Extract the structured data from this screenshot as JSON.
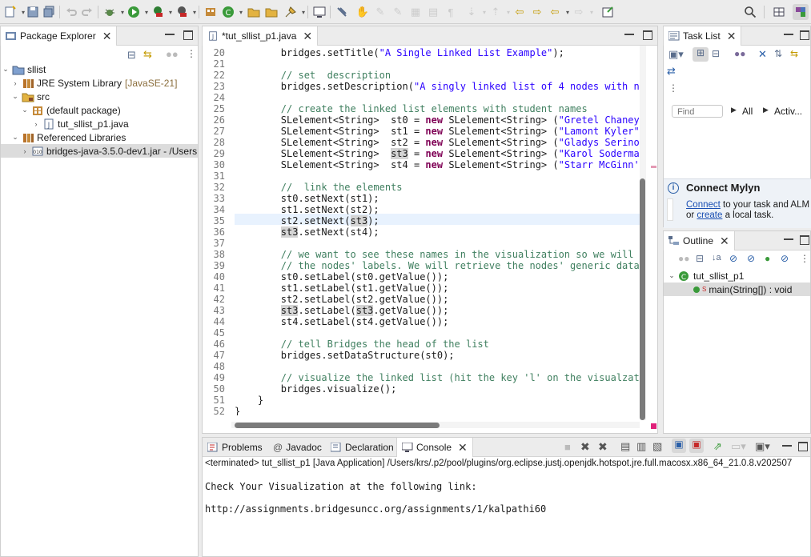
{
  "package_explorer": {
    "tab_label": "Package Explorer",
    "tree": [
      {
        "label": "sllist",
        "extra": ""
      },
      {
        "label": "JRE System Library",
        "extra": "[JavaSE-21]"
      },
      {
        "label": "src",
        "extra": ""
      },
      {
        "label": "(default package)",
        "extra": ""
      },
      {
        "label": "tut_sllist_p1.java",
        "extra": ""
      },
      {
        "label": "Referenced Libraries",
        "extra": ""
      },
      {
        "label": "bridges-java-3.5.0-dev1.jar - /Users",
        "extra": ""
      }
    ]
  },
  "editor": {
    "tab_label": "*tut_sllist_p1.java",
    "line_numbers": [
      "20",
      "21",
      "22",
      "23",
      "24",
      "25",
      "26",
      "27",
      "28",
      "29",
      "30",
      "31",
      "32",
      "33",
      "34",
      "35",
      "36",
      "37",
      "38",
      "39",
      "40",
      "41",
      "42",
      "43",
      "44",
      "45",
      "46",
      "47",
      "48",
      "49",
      "50",
      "51",
      "52"
    ],
    "lines": [
      "        bridges.setTitle(\"A Single Linked List Example\");",
      "",
      "        // set  description",
      "        bridges.setDescription(\"A singly linked list of 4 nodes with n",
      "",
      "        // create the linked list elements with student names",
      "        SLelement<String>  st0 = new SLelement<String> (\"Gretel Chaney",
      "        SLelement<String>  st1 = new SLelement<String> (\"Lamont Kyler\"",
      "        SLelement<String>  st2 = new SLelement<String> (\"Gladys Serino",
      "        SLelement<String>  st3 = new SLelement<String> (\"Karol Soderma",
      "        SLelement<String>  st4 = new SLelement<String> (\"Starr McGinn'",
      "",
      "        //  link the elements",
      "        st0.setNext(st1);",
      "        st1.setNext(st2);",
      "        st2.setNext(st3);",
      "        st3.setNext(st4);",
      "",
      "        // we want to see these names in the visualization so we will",
      "        // the nodes' labels. We will retrieve the nodes' generic data",
      "        st0.setLabel(st0.getValue());",
      "        st1.setLabel(st1.getValue());",
      "        st2.setLabel(st2.getValue());",
      "        st3.setLabel(st3.getValue());",
      "        st4.setLabel(st4.getValue());",
      "",
      "        // tell Bridges the head of the list",
      "        bridges.setDataStructure(st0);",
      "",
      "        // visualize the linked list (hit the key 'l' on the visualzat",
      "        bridges.visualize();",
      "    }",
      "}"
    ]
  },
  "task_list": {
    "tab_label": "Task List",
    "find_placeholder": "Find",
    "filter_all": "All",
    "filter_active": "Activ..."
  },
  "mylyn": {
    "title": "Connect Mylyn",
    "connect_link": "Connect",
    "text1": " to your task and ALM",
    "or": "or ",
    "create_link": "create",
    "text2": " a local task."
  },
  "outline": {
    "tab_label": "Outline",
    "class_name": "tut_sllist_p1",
    "method": "main(String[]) : void"
  },
  "bottom": {
    "tabs": [
      "Problems",
      "Javadoc",
      "Declaration",
      "Console"
    ],
    "status": "<terminated> tut_sllist_p1 [Java Application] /Users/krs/.p2/pool/plugins/org.eclipse.justj.openjdk.hotspot.jre.full.macosx.x86_64_21.0.8.v202507",
    "console_lines": [
      "Check Your Visualization at the following link:",
      "",
      "http://assignments.bridgesuncc.org/assignments/1/kalpathi60"
    ]
  },
  "colors": {
    "keyword": "#7f0055",
    "string": "#2a00ff",
    "comment": "#3f7f5f",
    "link": "#1a4fb3"
  }
}
